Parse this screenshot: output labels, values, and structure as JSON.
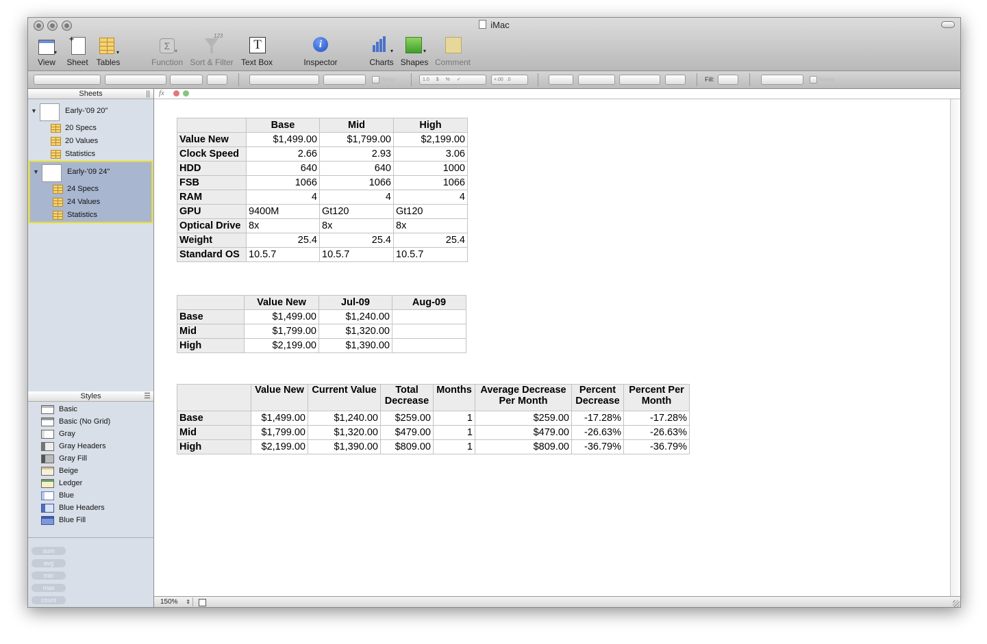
{
  "window": {
    "title": "iMac"
  },
  "toolbar": {
    "view": "View",
    "sheet": "Sheet",
    "tables": "Tables",
    "function": "Function",
    "sort_filter": "Sort & Filter",
    "text_box": "Text Box",
    "inspector": "Inspector",
    "charts": "Charts",
    "shapes": "Shapes",
    "comment": "Comment"
  },
  "formatbar": {
    "wrap": "Wrap",
    "fill": "Fill:",
    "name": "Name",
    "fmt_decimals_a": "1.0",
    "fmt_currency": "$",
    "fmt_percent": "%",
    "fmt_check": "✓",
    "fmt_inc": "+.00",
    "fmt_dec": ".0"
  },
  "sidebar": {
    "sheets_header": "Sheets",
    "sheets": [
      {
        "name": "Early-'09 20\"",
        "tables": [
          "20 Specs",
          "20 Values",
          "Statistics"
        ]
      },
      {
        "name": "Early-'09 24\"",
        "tables": [
          "24 Specs",
          "24 Values",
          "Statistics"
        ]
      }
    ],
    "styles_header": "Styles",
    "styles": [
      "Basic",
      "Basic (No Grid)",
      "Gray",
      "Gray Headers",
      "Gray Fill",
      "Beige",
      "Ledger",
      "Blue",
      "Blue Headers",
      "Blue Fill"
    ],
    "functions": [
      "sum",
      "avg",
      "min",
      "max",
      "count"
    ]
  },
  "formula_bar": {
    "fx": "fx"
  },
  "status": {
    "zoom": "150%"
  },
  "table1": {
    "headers": [
      "",
      "Base",
      "Mid",
      "High"
    ],
    "rows": [
      {
        "label": "Value New",
        "cells": [
          "$1,499.00",
          "$1,799.00",
          "$2,199.00"
        ]
      },
      {
        "label": "Clock Speed",
        "cells": [
          "2.66",
          "2.93",
          "3.06"
        ]
      },
      {
        "label": "HDD",
        "cells": [
          "640",
          "640",
          "1000"
        ]
      },
      {
        "label": "FSB",
        "cells": [
          "1066",
          "1066",
          "1066"
        ]
      },
      {
        "label": "RAM",
        "cells": [
          "4",
          "4",
          "4"
        ]
      },
      {
        "label": "GPU",
        "cells": [
          "9400M",
          "Gt120",
          "Gt120"
        ]
      },
      {
        "label": "Optical Drive",
        "cells": [
          "8x",
          "8x",
          "8x"
        ]
      },
      {
        "label": "Weight",
        "cells": [
          "25.4",
          "25.4",
          "25.4"
        ]
      },
      {
        "label": "Standard OS",
        "cells": [
          "10.5.7",
          "10.5.7",
          "10.5.7"
        ]
      }
    ]
  },
  "table2": {
    "headers": [
      "",
      "Value New",
      "Jul-09",
      "Aug-09"
    ],
    "rows": [
      {
        "label": "Base",
        "cells": [
          "$1,499.00",
          "$1,240.00",
          ""
        ]
      },
      {
        "label": "Mid",
        "cells": [
          "$1,799.00",
          "$1,320.00",
          ""
        ]
      },
      {
        "label": "High",
        "cells": [
          "$2,199.00",
          "$1,390.00",
          ""
        ]
      }
    ]
  },
  "table3": {
    "headers": [
      {
        "l1": "",
        "l2": ""
      },
      {
        "l1": "Value New",
        "l2": ""
      },
      {
        "l1": "Current Value",
        "l2": ""
      },
      {
        "l1": "Total",
        "l2": "Decrease"
      },
      {
        "l1": "Months",
        "l2": ""
      },
      {
        "l1": "Average Decrease",
        "l2": "Per Month"
      },
      {
        "l1": "Percent",
        "l2": "Decrease"
      },
      {
        "l1": "Percent Per",
        "l2": "Month"
      }
    ],
    "rows": [
      {
        "label": "Base",
        "cells": [
          "$1,499.00",
          "$1,240.00",
          "$259.00",
          "1",
          "$259.00",
          "-17.28%",
          "-17.28%"
        ]
      },
      {
        "label": "Mid",
        "cells": [
          "$1,799.00",
          "$1,320.00",
          "$479.00",
          "1",
          "$479.00",
          "-26.63%",
          "-26.63%"
        ]
      },
      {
        "label": "High",
        "cells": [
          "$2,199.00",
          "$1,390.00",
          "$809.00",
          "1",
          "$809.00",
          "-36.79%",
          "-36.79%"
        ]
      }
    ]
  }
}
